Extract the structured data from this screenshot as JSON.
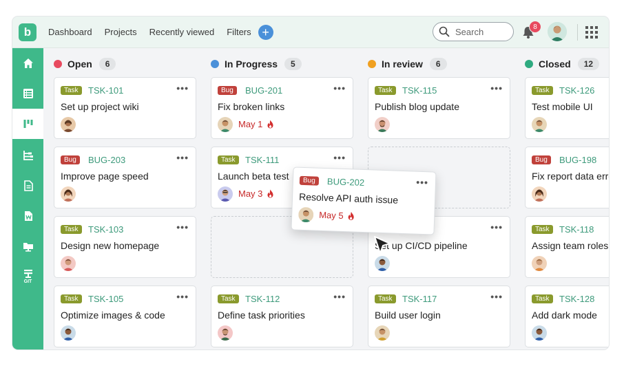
{
  "app": {
    "logo_letter": "b"
  },
  "nav": {
    "items": [
      "Dashboard",
      "Projects",
      "Recently viewed",
      "Filters"
    ],
    "add_icon": "plus-icon"
  },
  "search": {
    "placeholder": "Search"
  },
  "notifications": {
    "count": "8"
  },
  "colors": {
    "brand": "#3fb98a",
    "open": "#e84a5f",
    "in_progress": "#4a90d9",
    "in_review": "#f0a020",
    "closed": "#2eaa80",
    "task_tag": "#8a9a2d",
    "bug_tag": "#c0413b",
    "due": "#c62828"
  },
  "sidebar": {
    "icons": [
      "home-icon",
      "list-icon",
      "board-icon",
      "tree-icon",
      "document-icon",
      "word-icon",
      "folder-icon",
      "git-icon"
    ],
    "git_label": "GIT"
  },
  "columns": [
    {
      "name": "Open",
      "count": "6"
    },
    {
      "name": "In Progress",
      "count": "5"
    },
    {
      "name": "In review",
      "count": "6"
    },
    {
      "name": "Closed",
      "count": "12"
    }
  ],
  "cards": {
    "c0r0": {
      "tag": "Task",
      "key": "TSK-101",
      "title": "Set up project wiki"
    },
    "c0r1": {
      "tag": "Bug",
      "key": "BUG-203",
      "title": "Improve page speed"
    },
    "c0r2": {
      "tag": "Task",
      "key": "TSK-103",
      "title": "Design new homepage"
    },
    "c0r3": {
      "tag": "Task",
      "key": "TSK-105",
      "title": "Optimize images & code"
    },
    "c1r0": {
      "tag": "Bug",
      "key": "BUG-201",
      "title": "Fix broken links",
      "due": "May 1"
    },
    "c1r1": {
      "tag": "Task",
      "key": "TSK-111",
      "title": "Launch beta test",
      "due": "May 3"
    },
    "c1r3": {
      "tag": "Task",
      "key": "TSK-112",
      "title": "Define task priorities"
    },
    "c2r0": {
      "tag": "Task",
      "key": "TSK-115",
      "title": "Publish blog update"
    },
    "c2r2": {
      "title": "Set up CI/CD pipeline"
    },
    "c2r3": {
      "tag": "Task",
      "key": "TSK-117",
      "title": "Build user login"
    },
    "c3r0": {
      "tag": "Task",
      "key": "TSK-126",
      "title": "Test mobile UI"
    },
    "c3r1": {
      "tag": "Bug",
      "key": "BUG-198",
      "title": "Fix report data error"
    },
    "c3r2": {
      "tag": "Task",
      "key": "TSK-118",
      "title": "Assign team roles"
    },
    "c3r3": {
      "tag": "Task",
      "key": "TSK-128",
      "title": "Add dark mode"
    }
  },
  "dragging": {
    "tag": "Bug",
    "key": "BUG-202",
    "title": "Resolve API auth issue",
    "due": "May 5"
  },
  "more_glyph": "•••"
}
